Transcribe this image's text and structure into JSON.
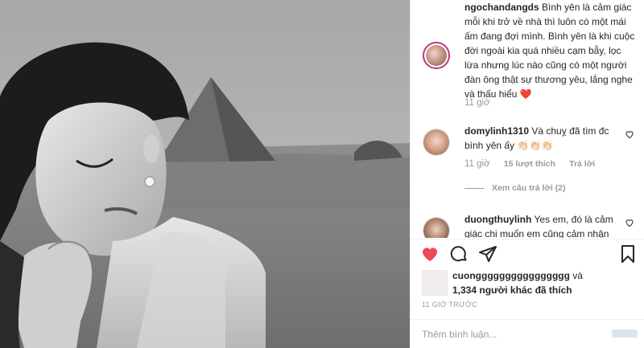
{
  "caption": {
    "username": "ngochandangds",
    "text": "Bình yên là cảm giác mỗi khi trở về nhà thì luôn có một mái ấm đang đợi mình. Bình yên là khi cuộc đời ngoài kia quá nhiều cạm bẫy, lọc lừa nhưng lúc nào cũng có một người đàn ông thật sự thương yêu, lắng nghe và thấu hiểu",
    "emoji": "❤️",
    "time": "11 giờ"
  },
  "comments": [
    {
      "username": "domylinh1310",
      "text": "Và chuỵ đã tìm đc bình yên ấy",
      "emoji": "👏🏻👏🏻👏🏻",
      "time": "11 giờ",
      "likes": "15 lượt thích",
      "reply": "Trả lời",
      "view_replies": "Xem câu trả lời (2)"
    },
    {
      "username": "duongthuylinh",
      "text": "Yes em, đó là cảm giác chị muốn em cũng cảm nhận"
    }
  ],
  "likes": {
    "first_user": "cuongggggggggggggggg",
    "connector": "và",
    "others": "1,334 người khác đã thích"
  },
  "time_ago": "11 GIỜ TRƯỚC",
  "input": {
    "placeholder": "Thêm bình luận..."
  },
  "icons": {
    "like": "heart-filled-icon",
    "comment": "comment-icon",
    "share": "share-icon",
    "save": "bookmark-icon",
    "like_color": "#ed4956"
  }
}
